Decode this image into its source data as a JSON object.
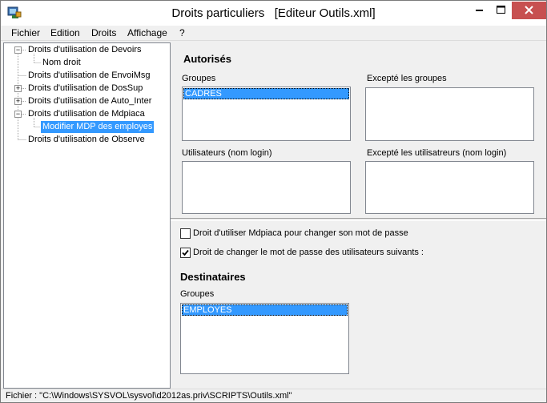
{
  "window": {
    "title": "Droits particuliers   [Editeur Outils.xml]"
  },
  "menu": [
    {
      "label": "Fichier"
    },
    {
      "label": "Edition"
    },
    {
      "label": "Droits"
    },
    {
      "label": "Affichage"
    },
    {
      "label": "?"
    }
  ],
  "tree": {
    "nodes": [
      {
        "label": "Droits d'utilisation de Devoirs",
        "expanded": true
      },
      {
        "label": "Nom droit"
      },
      {
        "label": "Droits d'utilisation de EnvoiMsg"
      },
      {
        "label": "Droits d'utilisation de DosSup",
        "expanded": false
      },
      {
        "label": "Droits d'utilisation de Auto_Inter",
        "expanded": false
      },
      {
        "label": "Droits d'utilisation de Mdpiaca",
        "expanded": true
      },
      {
        "label": "Modifier MDP des employes",
        "selected": true
      },
      {
        "label": "Droits d'utilisation de Observe"
      }
    ]
  },
  "autorises": {
    "heading": "Autorisés",
    "groupes_label": "Groupes",
    "groupes_items": [
      "CADRES"
    ],
    "except_groupes_label": "Excepté les groupes",
    "except_groupes_items": [],
    "utilisateurs_label": "Utilisateurs (nom login)",
    "utilisateurs_items": [],
    "except_utilisateurs_label": "Excepté les utilisatreurs (nom login)",
    "except_utilisateurs_items": []
  },
  "options": {
    "checkbox1": {
      "label": "Droit d'utiliser Mdpiaca pour changer son mot de passe",
      "checked": false
    },
    "checkbox2": {
      "label": "Droit de changer le mot de passe des utilisateurs suivants :",
      "checked": true
    }
  },
  "destinataires": {
    "heading": "Destinataires",
    "groupes_label": "Groupes",
    "groupes_items": [
      "EMPLOYES"
    ]
  },
  "status": {
    "text": "Fichier : \"C:\\Windows\\SYSVOL\\sysvol\\d2012as.priv\\SCRIPTS\\Outils.xml\""
  },
  "colors": {
    "selection": "#3399ff",
    "close_button": "#c75050"
  }
}
